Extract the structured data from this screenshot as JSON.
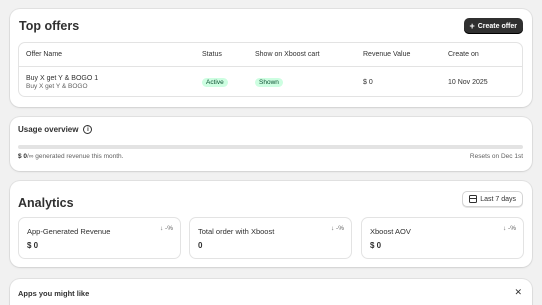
{
  "offers": {
    "title": "Top offers",
    "create_button": "Create offer",
    "columns": [
      "Offer Name",
      "Status",
      "Show on Xboost cart",
      "Revenue Value",
      "Create on"
    ],
    "rows": [
      {
        "name": "Buy X get Y & BOGO 1",
        "subtitle": "Buy X get Y & BOGO",
        "status": "Active",
        "cart_visibility": "Shown",
        "revenue": "$ 0",
        "created": "10 Nov 2025"
      }
    ]
  },
  "usage": {
    "title": "Usage overview",
    "info_icon": "info-icon",
    "amount": "$ 0",
    "amount_suffix": "/∞ generated revenue this month.",
    "reset_text": "Resets on Dec 1st",
    "progress": 0
  },
  "analytics": {
    "title": "Analytics",
    "range_button": "Last 7 days",
    "metrics": [
      {
        "label": "App-Generated Revenue",
        "value": "$ 0",
        "delta": "↓ -%"
      },
      {
        "label": "Total order with Xboost",
        "value": "0",
        "delta": "↓ -%"
      },
      {
        "label": "Xboost AOV",
        "value": "$ 0",
        "delta": "↓ -%"
      }
    ]
  },
  "apps": {
    "title": "Apps you might like",
    "close_icon": "close-icon"
  },
  "colors": {
    "background": "#f1f1f1",
    "card": "#ffffff",
    "primary_button": "#303030",
    "badge_bg": "#cdfee1",
    "badge_text": "#0c5132"
  }
}
